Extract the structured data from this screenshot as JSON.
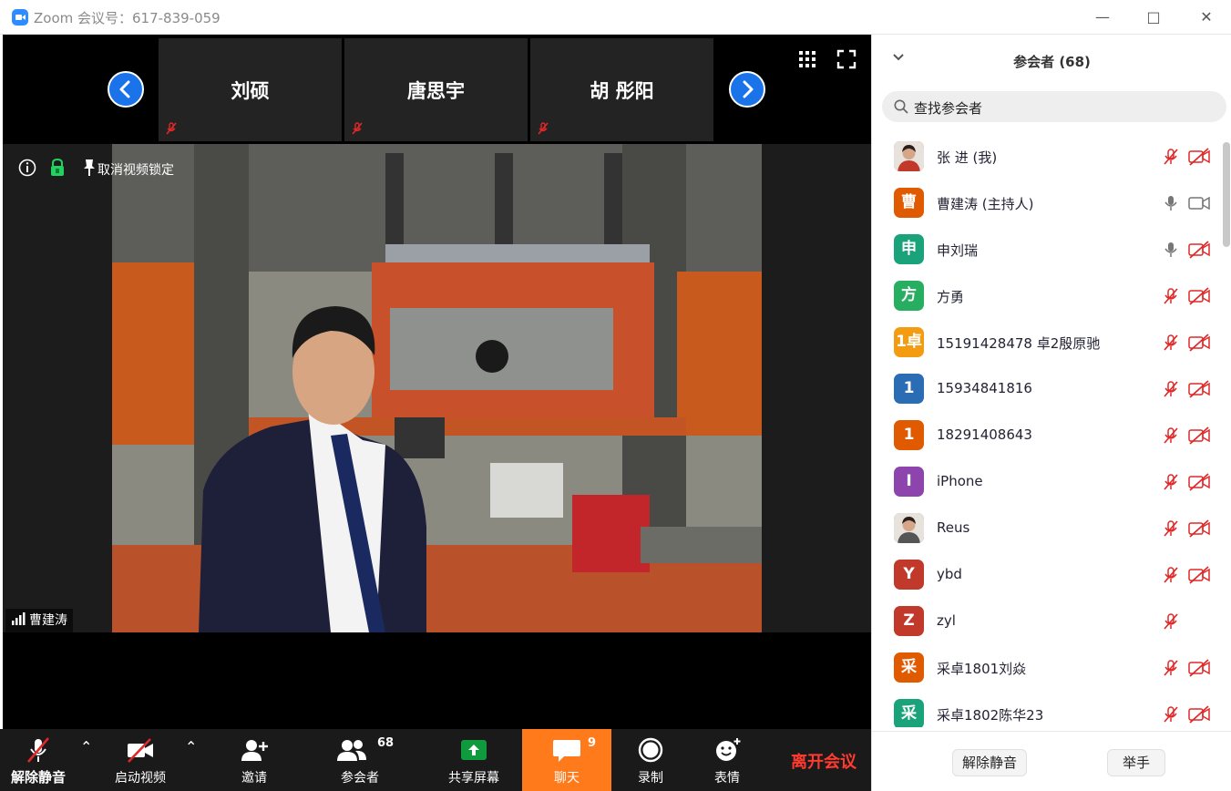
{
  "window": {
    "title": "Zoom 会议号：617-839-059"
  },
  "strip": {
    "tiles": [
      {
        "name": "刘硕"
      },
      {
        "name": "唐思宇"
      },
      {
        "name": "胡 彤阳"
      }
    ]
  },
  "video": {
    "pin_label": "取消视频锁定",
    "speaker_name": "曹建涛"
  },
  "toolbar": {
    "unmute": "解除静音",
    "start_video": "启动视频",
    "invite": "邀请",
    "participants": "参会者",
    "participants_count": "68",
    "share": "共享屏幕",
    "chat": "聊天",
    "chat_count": "9",
    "record": "录制",
    "reactions": "表情",
    "leave": "离开会议"
  },
  "panel": {
    "title": "参会者 (68)",
    "search_placeholder": "查找参会者",
    "participants": [
      {
        "name": "张 进 (我)",
        "avatar": "",
        "color": "#c0392b",
        "mic": "muted",
        "cam": "off"
      },
      {
        "name": "曹建涛 (主持人)",
        "avatar": "曹",
        "color": "#e05a00",
        "mic": "on",
        "cam": "on"
      },
      {
        "name": "申刘瑞",
        "avatar": "申",
        "color": "#1aa37a",
        "mic": "on",
        "cam": "off"
      },
      {
        "name": " 方勇",
        "avatar": "方",
        "color": "#27ae60",
        "mic": "muted",
        "cam": "off"
      },
      {
        "name": "15191428478 卓2殷原驰",
        "avatar": "1卓",
        "color": "#f39c12",
        "mic": "muted",
        "cam": "off"
      },
      {
        "name": "15934841816",
        "avatar": "1",
        "color": "#2a6db5",
        "mic": "muted",
        "cam": "off"
      },
      {
        "name": "18291408643",
        "avatar": "1",
        "color": "#e05a00",
        "mic": "muted",
        "cam": "off"
      },
      {
        "name": "iPhone",
        "avatar": "I",
        "color": "#8e44ad",
        "mic": "muted",
        "cam": "off"
      },
      {
        "name": "Reus",
        "avatar": "",
        "color": "#555555",
        "mic": "muted",
        "cam": "off"
      },
      {
        "name": "ybd",
        "avatar": "Y",
        "color": "#c0392b",
        "mic": "muted",
        "cam": "off"
      },
      {
        "name": "zyl",
        "avatar": "Z",
        "color": "#c0392b",
        "mic": "muted",
        "cam": "none"
      },
      {
        "name": "采卓1801刘焱",
        "avatar": "采",
        "color": "#e05a00",
        "mic": "muted",
        "cam": "off"
      },
      {
        "name": "采卓1802陈华23",
        "avatar": "采",
        "color": "#1aa37a",
        "mic": "muted",
        "cam": "off"
      }
    ],
    "footer": {
      "unmute_all": "解除静音",
      "raise_hand": "举手"
    }
  }
}
